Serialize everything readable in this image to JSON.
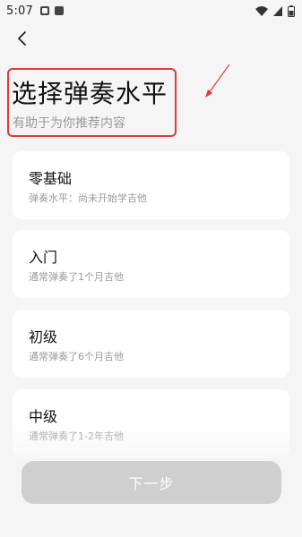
{
  "status_bar": {
    "time": "5:07"
  },
  "header": {
    "title": "选择弹奏水平",
    "subtitle": "有助于为你推荐内容"
  },
  "levels": [
    {
      "name": "零基础",
      "description": "弹奏水平：尚未开始学吉他"
    },
    {
      "name": "入门",
      "description": "通常弹奏了1个月吉他"
    },
    {
      "name": "初级",
      "description": "通常弹奏了6个月吉他"
    },
    {
      "name": "中级",
      "description": "通常弹奏了1-2年吉他"
    }
  ],
  "footer": {
    "next_label": "下一步"
  },
  "colors": {
    "highlight_border": "#e53935",
    "button_disabled": "#cfcfcf",
    "background": "#f5f5f5"
  }
}
